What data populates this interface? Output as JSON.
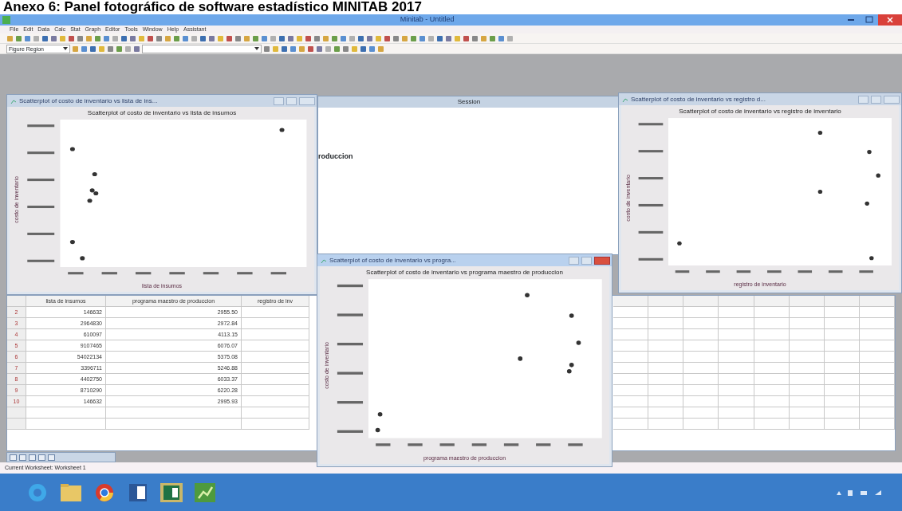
{
  "caption": "Anexo 6: Panel fotográfico de software estadístico MINITAB 2017",
  "window": {
    "title": "Minitab - Untitled"
  },
  "menu": [
    "File",
    "Edit",
    "Data",
    "Calc",
    "Stat",
    "Graph",
    "Editor",
    "Tools",
    "Window",
    "Help",
    "Assistant"
  ],
  "toolbar": {
    "combo": "Figure Region"
  },
  "session": {
    "title": "Session",
    "text": "roduccion"
  },
  "worksheet": {
    "columns": [
      "lista de insumos",
      "programa maestro de produccion",
      "registro de inv"
    ],
    "rows": [
      [
        "2",
        "146632",
        "2955.50"
      ],
      [
        "3",
        "2964830",
        "2972.84"
      ],
      [
        "4",
        "610097",
        "4113.15"
      ],
      [
        "5",
        "9107465",
        "6076.07"
      ],
      [
        "6",
        "54022134",
        "5375.08"
      ],
      [
        "7",
        "3396711",
        "5246.88"
      ],
      [
        "8",
        "4402750",
        "6033.37"
      ],
      [
        "9",
        "8710290",
        "6220.28"
      ],
      [
        "10",
        "146632",
        "2995.93"
      ]
    ]
  },
  "graphs": [
    {
      "title": "Scatterplot of costo de inventario vs lista de ins...",
      "chart_title": "Scatterplot of costo de inventario vs lista de insumos",
      "xlabel": "lista de insumos",
      "ylabel": "costo de inventario",
      "active": false
    },
    {
      "title": "Scatterplot of costo de inventario vs registro d...",
      "chart_title": "Scatterplot of costo de inventario vs registro de inventario",
      "xlabel": "registro de inventario",
      "ylabel": "costo de inventario",
      "active": false
    },
    {
      "title": "Scatterplot of costo de inventario vs progra...",
      "chart_title": "Scatterplot of costo de inventario vs programa maestro de produccion",
      "xlabel": "programa maestro de produccion",
      "ylabel": "costo de inventario",
      "active": true
    }
  ],
  "status_bar": "Current Worksheet: Worksheet 1"
}
